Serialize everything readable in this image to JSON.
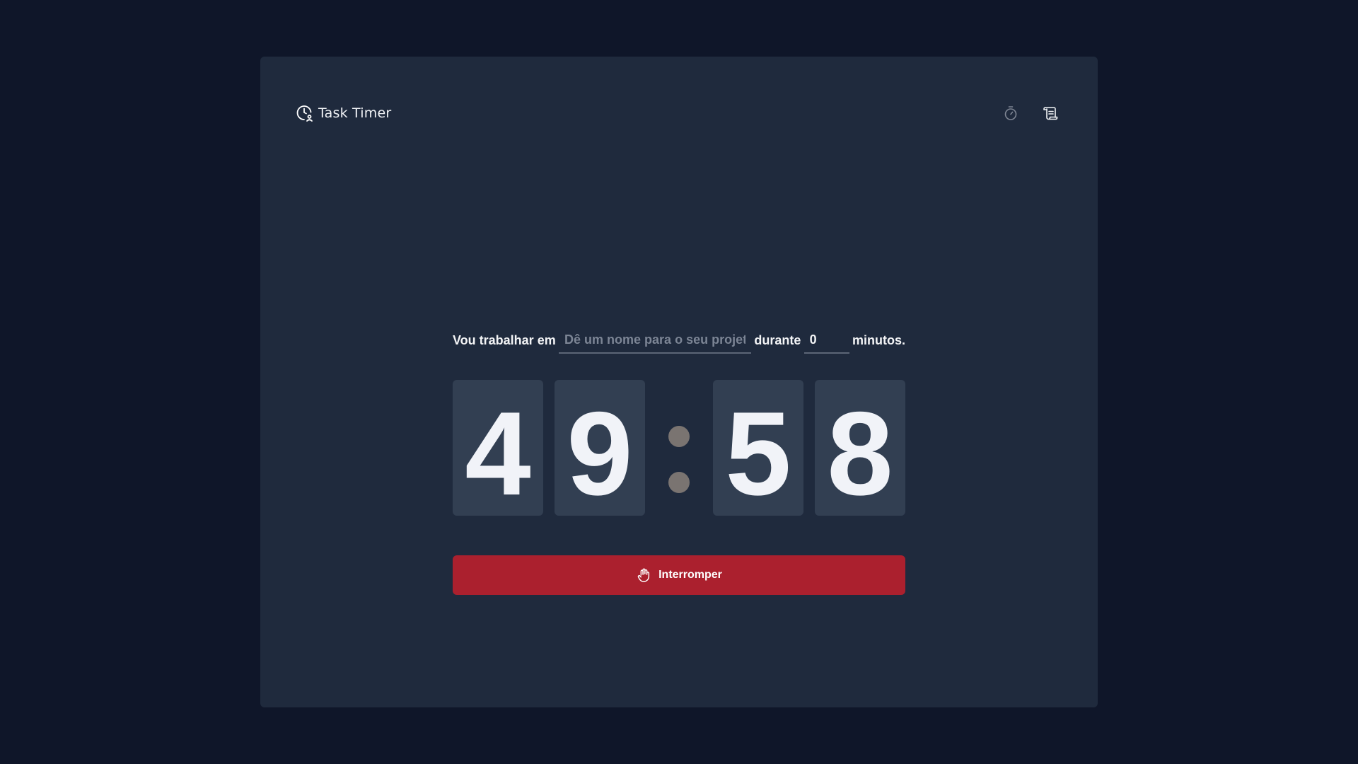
{
  "app": {
    "name": "Task Timer",
    "logo_icon": "timer-logo-icon"
  },
  "nav": {
    "items": [
      {
        "name": "timer",
        "icon": "stopwatch-icon",
        "active": true
      },
      {
        "name": "history",
        "icon": "scroll-icon",
        "active": false
      }
    ]
  },
  "form": {
    "label_task": "Vou trabalhar em",
    "task_placeholder": "Dê um nome para o seu projeto",
    "task_value": "",
    "label_duration": "durante",
    "minutes_value": "0",
    "label_minutes": "minutos."
  },
  "countdown": {
    "minutes_tens": "4",
    "minutes_ones": "9",
    "separator": ":",
    "seconds_tens": "5",
    "seconds_ones": "8"
  },
  "stop_button": {
    "label": "Interromper",
    "icon": "hand-palm-icon"
  },
  "colors": {
    "background": "#0f1629",
    "panel": "#1f2a3d",
    "digit_box": "#323f52",
    "stop_button": "#ab202e",
    "separator_dot": "#7a7471"
  }
}
